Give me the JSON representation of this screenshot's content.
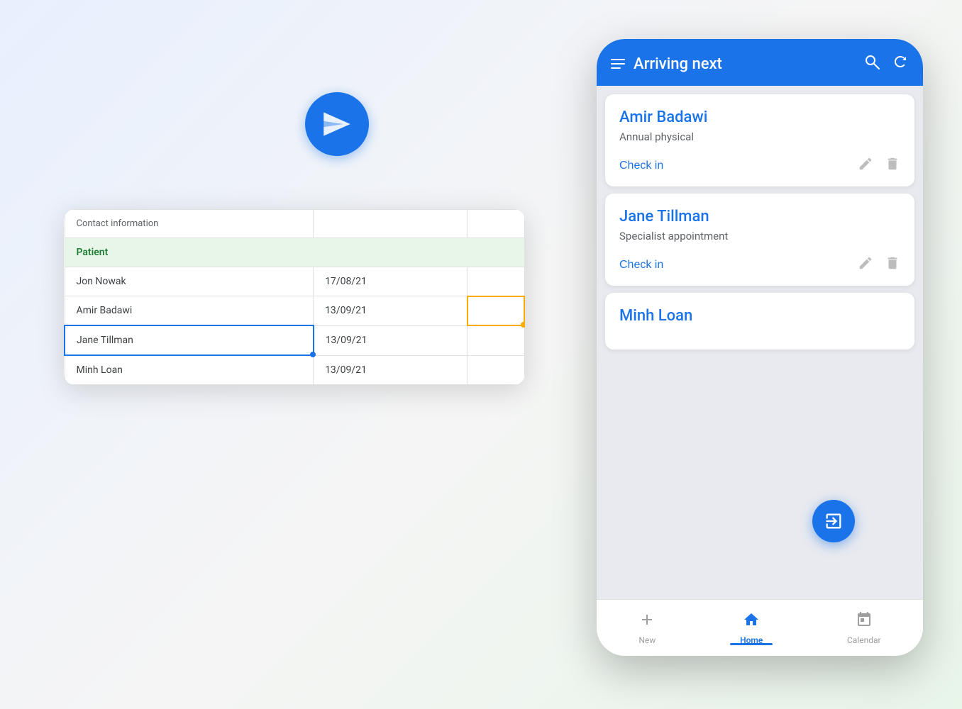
{
  "app": {
    "title": "Arriving next"
  },
  "paperPlane": {
    "icon": "✈"
  },
  "spreadsheet": {
    "headers": [
      "Contact information",
      "",
      ""
    ],
    "sectionLabel": "Patient",
    "rows": [
      {
        "name": "Jon Nowak",
        "date": "17/08/21",
        "extra": "",
        "selected": false,
        "yellowCell": false
      },
      {
        "name": "Amir Badawi",
        "date": "13/09/21",
        "extra": "",
        "selected": false,
        "yellowCell": true
      },
      {
        "name": "Jane Tillman",
        "date": "13/09/21",
        "extra": "",
        "selected": true,
        "yellowCell": false
      },
      {
        "name": "Minh Loan",
        "date": "13/09/21",
        "extra": "",
        "selected": false,
        "yellowCell": false
      }
    ]
  },
  "phone": {
    "header": {
      "title": "Arriving next",
      "searchIcon": "🔍",
      "refreshIcon": "↻"
    },
    "appointments": [
      {
        "name": "Amir Badawi",
        "type": "Annual physical",
        "checkIn": "Check in"
      },
      {
        "name": "Jane Tillman",
        "type": "Specialist appointment",
        "checkIn": "Check in"
      },
      {
        "name": "Minh Loan",
        "type": "",
        "checkIn": ""
      }
    ],
    "nav": {
      "items": [
        {
          "label": "New",
          "active": false
        },
        {
          "label": "Home",
          "active": true
        },
        {
          "label": "Calendar",
          "active": false
        }
      ]
    }
  }
}
